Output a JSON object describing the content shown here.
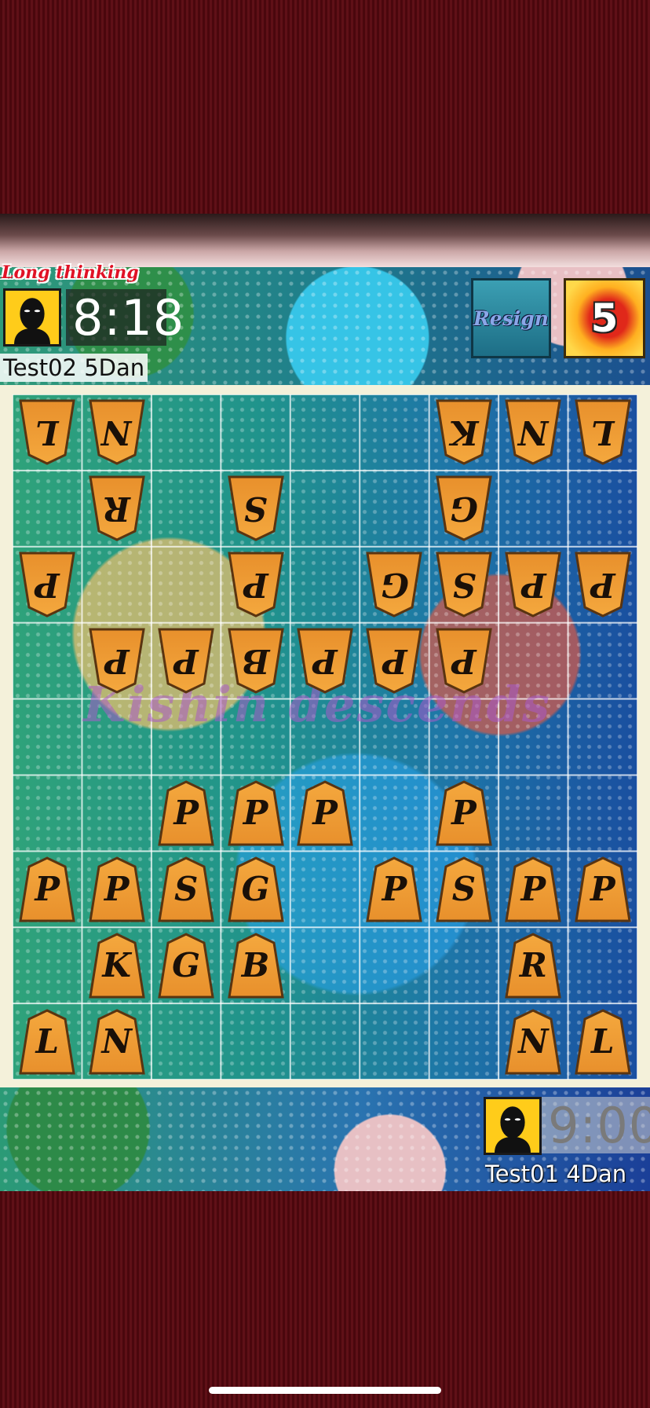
{
  "status_label": "Long thinking",
  "opponent": {
    "clock": "8:18",
    "name": "Test02 5Dan"
  },
  "player": {
    "clock": "9:00",
    "name": "Test01 4Dan"
  },
  "resign_label": "Resign",
  "move_count": "5",
  "watermark": "Kishin descends",
  "board": {
    "files": 9,
    "ranks": 9,
    "pieces": [
      {
        "file": 0,
        "rank": 0,
        "label": "L",
        "side": "gote"
      },
      {
        "file": 1,
        "rank": 0,
        "label": "N",
        "side": "gote"
      },
      {
        "file": 6,
        "rank": 0,
        "label": "K",
        "side": "gote"
      },
      {
        "file": 7,
        "rank": 0,
        "label": "N",
        "side": "gote"
      },
      {
        "file": 8,
        "rank": 0,
        "label": "L",
        "side": "gote"
      },
      {
        "file": 1,
        "rank": 1,
        "label": "R",
        "side": "gote"
      },
      {
        "file": 3,
        "rank": 1,
        "label": "S",
        "side": "gote"
      },
      {
        "file": 6,
        "rank": 1,
        "label": "G",
        "side": "gote"
      },
      {
        "file": 0,
        "rank": 2,
        "label": "P",
        "side": "gote"
      },
      {
        "file": 3,
        "rank": 2,
        "label": "P",
        "side": "gote"
      },
      {
        "file": 5,
        "rank": 2,
        "label": "G",
        "side": "gote"
      },
      {
        "file": 6,
        "rank": 2,
        "label": "S",
        "side": "gote"
      },
      {
        "file": 7,
        "rank": 2,
        "label": "P",
        "side": "gote"
      },
      {
        "file": 8,
        "rank": 2,
        "label": "P",
        "side": "gote"
      },
      {
        "file": 1,
        "rank": 3,
        "label": "P",
        "side": "gote"
      },
      {
        "file": 2,
        "rank": 3,
        "label": "P",
        "side": "gote"
      },
      {
        "file": 3,
        "rank": 3,
        "label": "B",
        "side": "gote"
      },
      {
        "file": 4,
        "rank": 3,
        "label": "P",
        "side": "gote"
      },
      {
        "file": 5,
        "rank": 3,
        "label": "P",
        "side": "gote"
      },
      {
        "file": 6,
        "rank": 3,
        "label": "P",
        "side": "gote"
      },
      {
        "file": 2,
        "rank": 5,
        "label": "P",
        "side": "sente"
      },
      {
        "file": 3,
        "rank": 5,
        "label": "P",
        "side": "sente"
      },
      {
        "file": 4,
        "rank": 5,
        "label": "P",
        "side": "sente"
      },
      {
        "file": 6,
        "rank": 5,
        "label": "P",
        "side": "sente"
      },
      {
        "file": 0,
        "rank": 6,
        "label": "P",
        "side": "sente"
      },
      {
        "file": 1,
        "rank": 6,
        "label": "P",
        "side": "sente"
      },
      {
        "file": 2,
        "rank": 6,
        "label": "S",
        "side": "sente"
      },
      {
        "file": 3,
        "rank": 6,
        "label": "G",
        "side": "sente"
      },
      {
        "file": 5,
        "rank": 6,
        "label": "P",
        "side": "sente"
      },
      {
        "file": 6,
        "rank": 6,
        "label": "S",
        "side": "sente"
      },
      {
        "file": 7,
        "rank": 6,
        "label": "P",
        "side": "sente"
      },
      {
        "file": 8,
        "rank": 6,
        "label": "P",
        "side": "sente"
      },
      {
        "file": 1,
        "rank": 7,
        "label": "K",
        "side": "sente"
      },
      {
        "file": 2,
        "rank": 7,
        "label": "G",
        "side": "sente"
      },
      {
        "file": 3,
        "rank": 7,
        "label": "B",
        "side": "sente"
      },
      {
        "file": 7,
        "rank": 7,
        "label": "R",
        "side": "sente"
      },
      {
        "file": 0,
        "rank": 8,
        "label": "L",
        "side": "sente"
      },
      {
        "file": 1,
        "rank": 8,
        "label": "N",
        "side": "sente"
      },
      {
        "file": 7,
        "rank": 8,
        "label": "N",
        "side": "sente"
      },
      {
        "file": 8,
        "rank": 8,
        "label": "L",
        "side": "sente"
      }
    ]
  },
  "colors": {
    "background": "#5a0810",
    "piece_face": "#e8902c",
    "status_red": "#e01226",
    "avatar_yellow": "#ffcc1a"
  },
  "icons": {
    "avatar": "faceless-mask-avatar-icon"
  }
}
